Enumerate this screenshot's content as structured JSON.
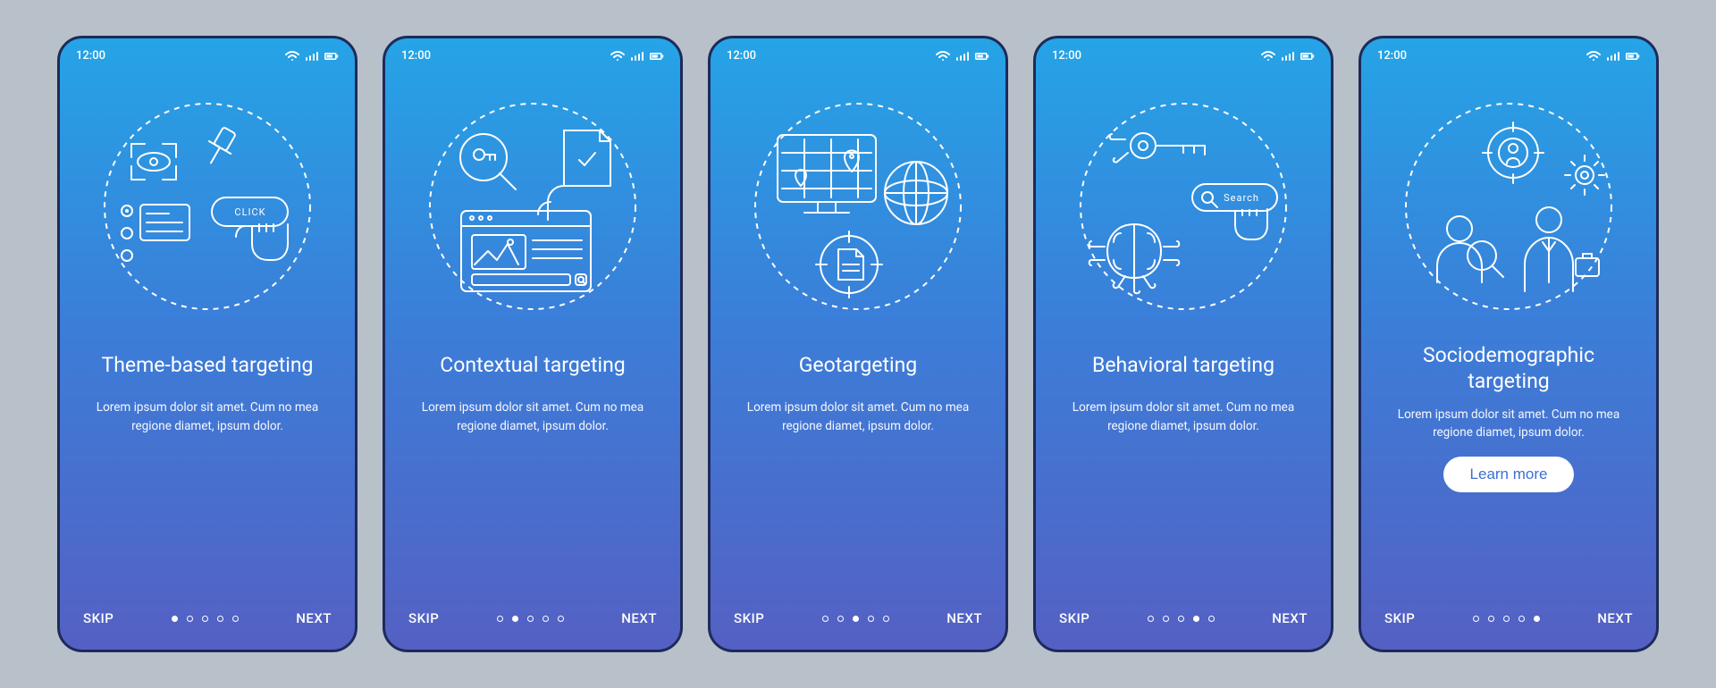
{
  "status": {
    "time": "12:00"
  },
  "nav": {
    "skip": "SKIP",
    "next": "NEXT"
  },
  "cta_label": "Learn more",
  "screens": [
    {
      "title": "Theme-based targeting",
      "body": "Lorem ipsum dolor sit amet. Cum no mea regione diamet, ipsum dolor.",
      "icon": "theme-icon",
      "click_label": "CLICK",
      "active_dot": 0,
      "cta": false
    },
    {
      "title": "Contextual targeting",
      "body": "Lorem ipsum dolor sit amet. Cum no mea regione diamet, ipsum dolor.",
      "icon": "contextual-icon",
      "active_dot": 1,
      "cta": false
    },
    {
      "title": "Geotargeting",
      "body": "Lorem ipsum dolor sit amet. Cum no mea regione diamet, ipsum dolor.",
      "icon": "geo-icon",
      "active_dot": 2,
      "cta": false
    },
    {
      "title": "Behavioral targeting",
      "body": "Lorem ipsum dolor sit amet. Cum no mea regione diamet, ipsum dolor.",
      "icon": "behavioral-icon",
      "search_label": "Search",
      "active_dot": 3,
      "cta": false
    },
    {
      "title": "Sociodemographic targeting",
      "body": "Lorem ipsum dolor sit amet. Cum no mea regione diamet, ipsum dolor.",
      "icon": "socio-icon",
      "active_dot": 4,
      "cta": true
    }
  ]
}
